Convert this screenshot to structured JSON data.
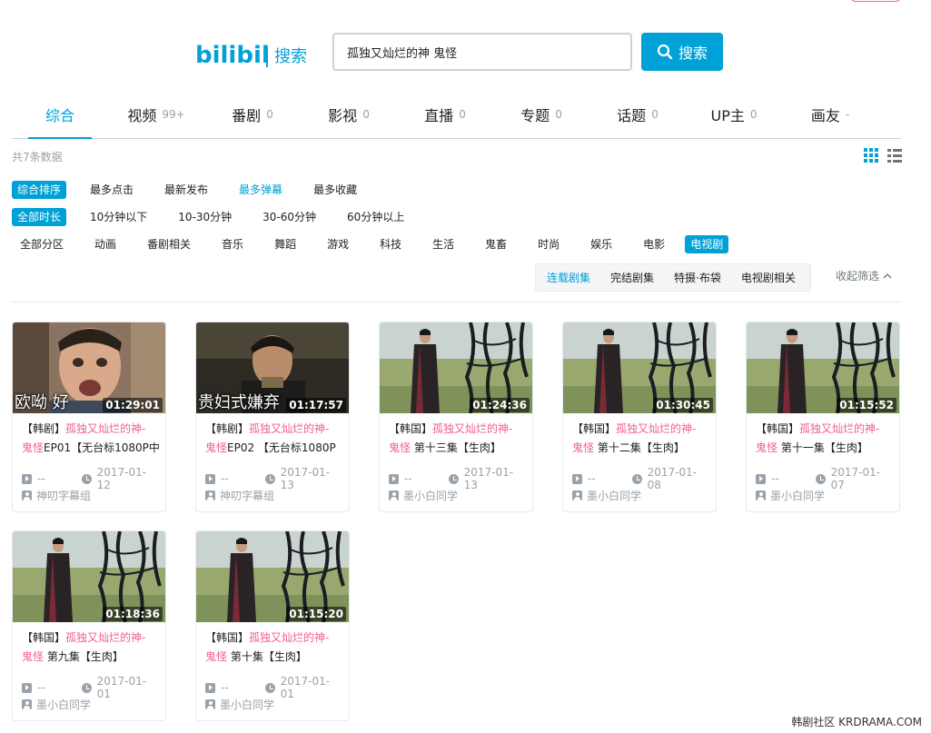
{
  "header": {
    "logo_text": "bilibili",
    "page_label": "搜索",
    "search_value": "孤独又灿烂的神 鬼怪",
    "search_button": "搜索"
  },
  "tabs": [
    {
      "label": "综合",
      "count": ""
    },
    {
      "label": "视频",
      "count": "99+"
    },
    {
      "label": "番剧",
      "count": "0"
    },
    {
      "label": "影视",
      "count": "0"
    },
    {
      "label": "直播",
      "count": "0"
    },
    {
      "label": "专题",
      "count": "0"
    },
    {
      "label": "话题",
      "count": "0"
    },
    {
      "label": "UP主",
      "count": "0"
    },
    {
      "label": "画友",
      "count": "-"
    }
  ],
  "summary": "共7条数据",
  "sort_filters": [
    "综合排序",
    "最多点击",
    "最新发布",
    "最多弹幕",
    "最多收藏"
  ],
  "duration_filters": [
    "全部时长",
    "10分钟以下",
    "10-30分钟",
    "30-60分钟",
    "60分钟以上"
  ],
  "category_filters": [
    "全部分区",
    "动画",
    "番剧相关",
    "音乐",
    "舞蹈",
    "游戏",
    "科技",
    "生活",
    "鬼畜",
    "时尚",
    "娱乐",
    "电影",
    "电视剧"
  ],
  "sub_filters": [
    "连载剧集",
    "完结剧集",
    "特摄·布袋",
    "电视剧相关"
  ],
  "collapse_label": "收起筛选",
  "results": [
    {
      "title_pre": "【韩剧】",
      "title_kw1": "孤独又灿烂的神-",
      "title_kw2": "鬼怪",
      "title_post": "EP01【无台标1080P中",
      "duration": "01:29:01",
      "caption": "欧呦   好",
      "plays": "--",
      "date": "2017-01-12",
      "uploader": "神叨字幕组"
    },
    {
      "title_pre": "【韩剧】",
      "title_kw1": "孤独又灿烂的神-",
      "title_kw2": "鬼怪",
      "title_post": "EP02 【无台标1080P",
      "duration": "01:17:57",
      "caption": "贵妇式嫌弃",
      "plays": "--",
      "date": "2017-01-13",
      "uploader": "神叨字幕组"
    },
    {
      "title_pre": "【韩国】",
      "title_kw1": "孤独又灿烂的神-",
      "title_kw2": "鬼怪",
      "title_post": " 第十三集【生肉】",
      "duration": "01:24:36",
      "caption": "",
      "plays": "--",
      "date": "2017-01-13",
      "uploader": "墨小白同学"
    },
    {
      "title_pre": "【韩国】",
      "title_kw1": "孤独又灿烂的神-",
      "title_kw2": "鬼怪",
      "title_post": " 第十二集【生肉】",
      "duration": "01:30:45",
      "caption": "",
      "plays": "--",
      "date": "2017-01-08",
      "uploader": "墨小白同学"
    },
    {
      "title_pre": "【韩国】",
      "title_kw1": "孤独又灿烂的神-",
      "title_kw2": "鬼怪",
      "title_post": " 第十一集【生肉】",
      "duration": "01:15:52",
      "caption": "",
      "plays": "--",
      "date": "2017-01-07",
      "uploader": "墨小白同学"
    },
    {
      "title_pre": "【韩国】",
      "title_kw1": "孤独又灿烂的神-",
      "title_kw2": "鬼怪",
      "title_post": " 第九集【生肉】",
      "duration": "01:18:36",
      "caption": "",
      "plays": "--",
      "date": "2017-01-01",
      "uploader": "墨小白同学"
    },
    {
      "title_pre": "【韩国】",
      "title_kw1": "孤独又灿烂的神-",
      "title_kw2": "鬼怪",
      "title_post": " 第十集【生肉】",
      "duration": "01:15:20",
      "caption": "",
      "plays": "--",
      "date": "2017-01-01",
      "uploader": "墨小白同学"
    }
  ],
  "watermark": "韩剧社区 KRDRAMA.COM",
  "colors": {
    "accent": "#00a1d6",
    "keyword": "#f25d8e"
  }
}
